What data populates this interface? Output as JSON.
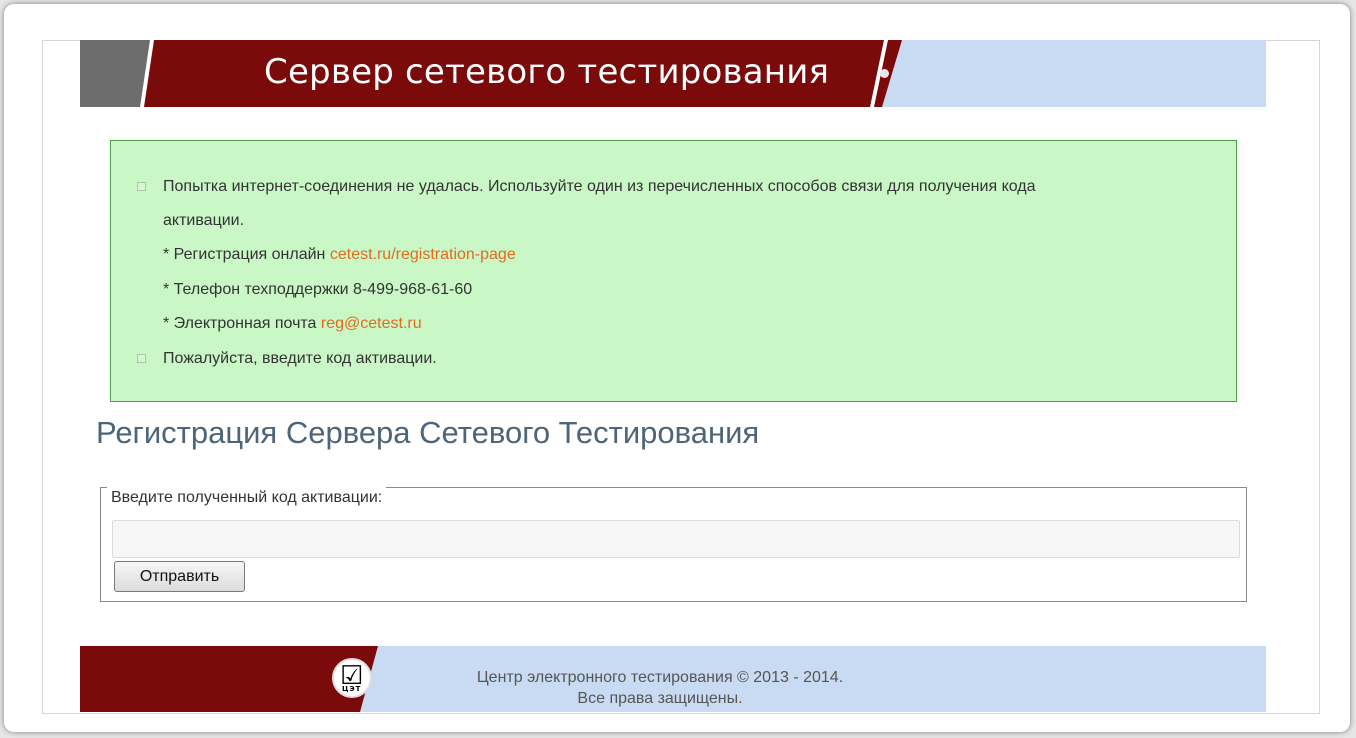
{
  "header": {
    "title": "Сервер сетевого тестирования"
  },
  "alert": {
    "message1_line1": "Попытка интернет-соединения не удалась. Используйте один из перечисленных способов связи для получения кода",
    "message1_line2": "активации.",
    "online_prefix": "* Регистрация онлайн ",
    "online_link": "cetest.ru/registration-page",
    "phone": "* Телефон техподдержки 8-499-968-61-60",
    "email_prefix": "* Электронная почта ",
    "email_link": "reg@cetest.ru",
    "message2": "Пожалуйста, введите код активации."
  },
  "main": {
    "heading": "Регистрация Сервера Сетевого Тестирования"
  },
  "form": {
    "legend": "Введите полученный код активации:",
    "activation_code_value": "",
    "submit_label": "Отправить"
  },
  "footer": {
    "logo_text": "ЦЭТ",
    "copyright": "Центр электронного тестирования © 2013 - 2014.",
    "rights": "Все права защищены."
  },
  "colors": {
    "banner_red": "#7b0a0a",
    "banner_light": "#c9dbf2",
    "alert_bg": "#c9f8c6",
    "link": "#e26b1e",
    "heading": "#4d6479"
  }
}
